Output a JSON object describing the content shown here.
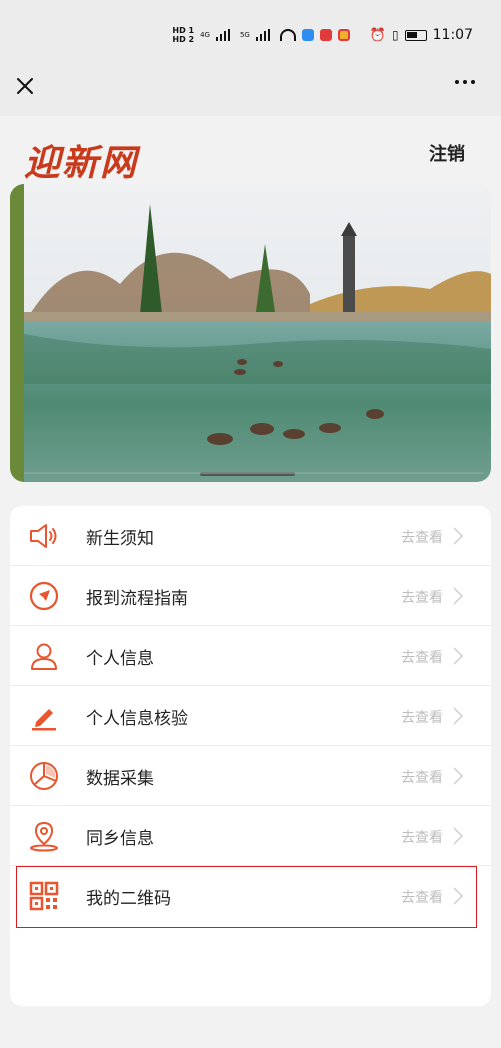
{
  "statusbar": {
    "time": "11:07",
    "hd1": "HD 1",
    "hd2": "HD 2",
    "net1": "4G",
    "net2": "5G"
  },
  "nav": {
    "close_icon": "close-icon",
    "more_icon": "more-icon"
  },
  "header": {
    "logo": "迎新网",
    "logout": "注销"
  },
  "menu": {
    "items": [
      {
        "label": "新生须知",
        "action": "去查看",
        "icon": "megaphone-icon"
      },
      {
        "label": "报到流程指南",
        "action": "去查看",
        "icon": "compass-icon"
      },
      {
        "label": "个人信息",
        "action": "去查看",
        "icon": "person-icon"
      },
      {
        "label": "个人信息核验",
        "action": "去查看",
        "icon": "pencil-icon"
      },
      {
        "label": "数据采集",
        "action": "去查看",
        "icon": "pie-chart-icon"
      },
      {
        "label": "同乡信息",
        "action": "去查看",
        "icon": "location-pin-icon"
      },
      {
        "label": "我的二维码",
        "action": "去查看",
        "icon": "qr-code-icon"
      }
    ]
  },
  "colors": {
    "accent": "#e8552f",
    "logo": "#c93a1c",
    "highlight": "#d81e1e"
  }
}
